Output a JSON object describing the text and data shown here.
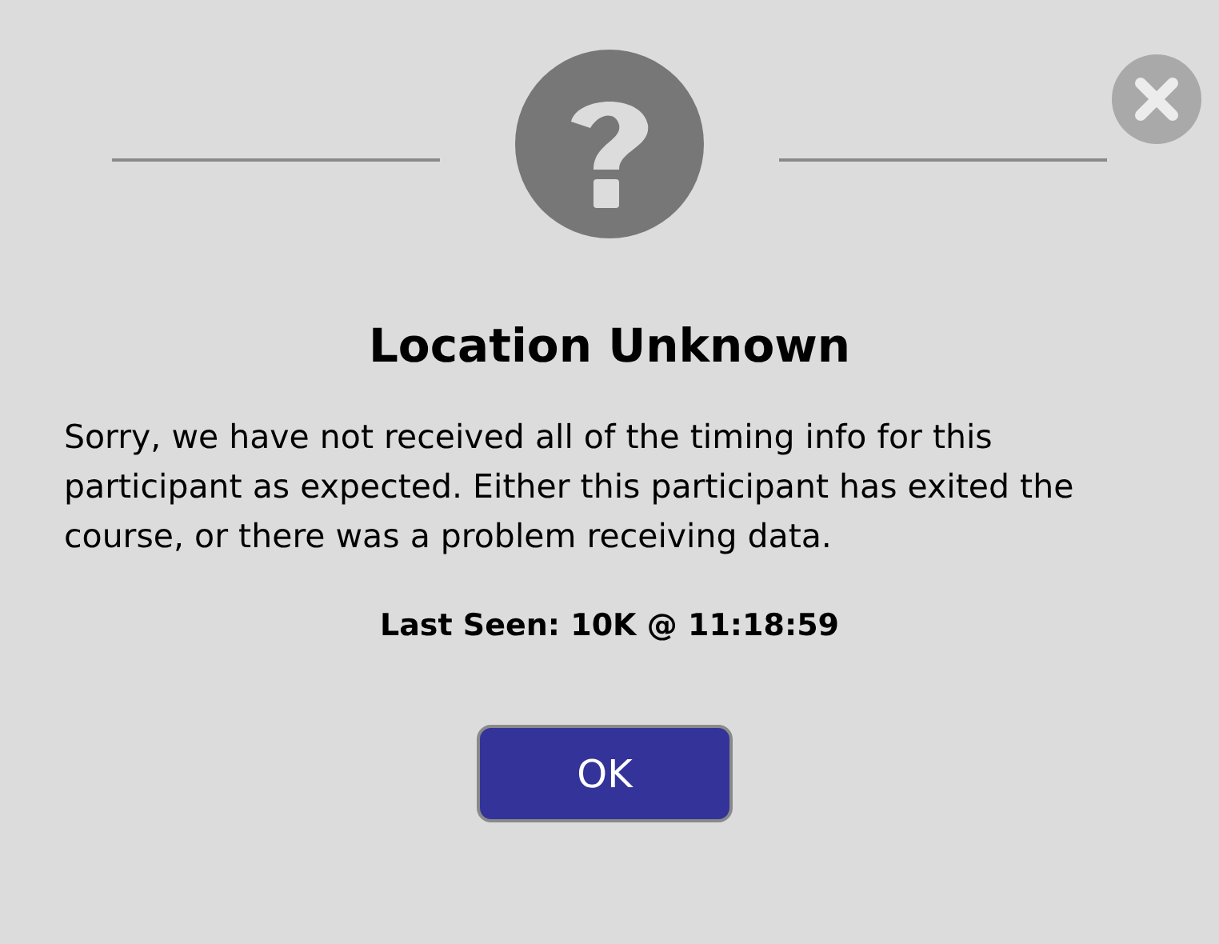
{
  "dialog": {
    "title": "Location Unknown",
    "message": "Sorry, we have not received all of the timing info for this participant as expected. Either this participant has exited the course, or there was a problem receiving data.",
    "last_seen": "Last Seen: 10K @ 11:18:59",
    "buttons": [
      "OK"
    ]
  }
}
